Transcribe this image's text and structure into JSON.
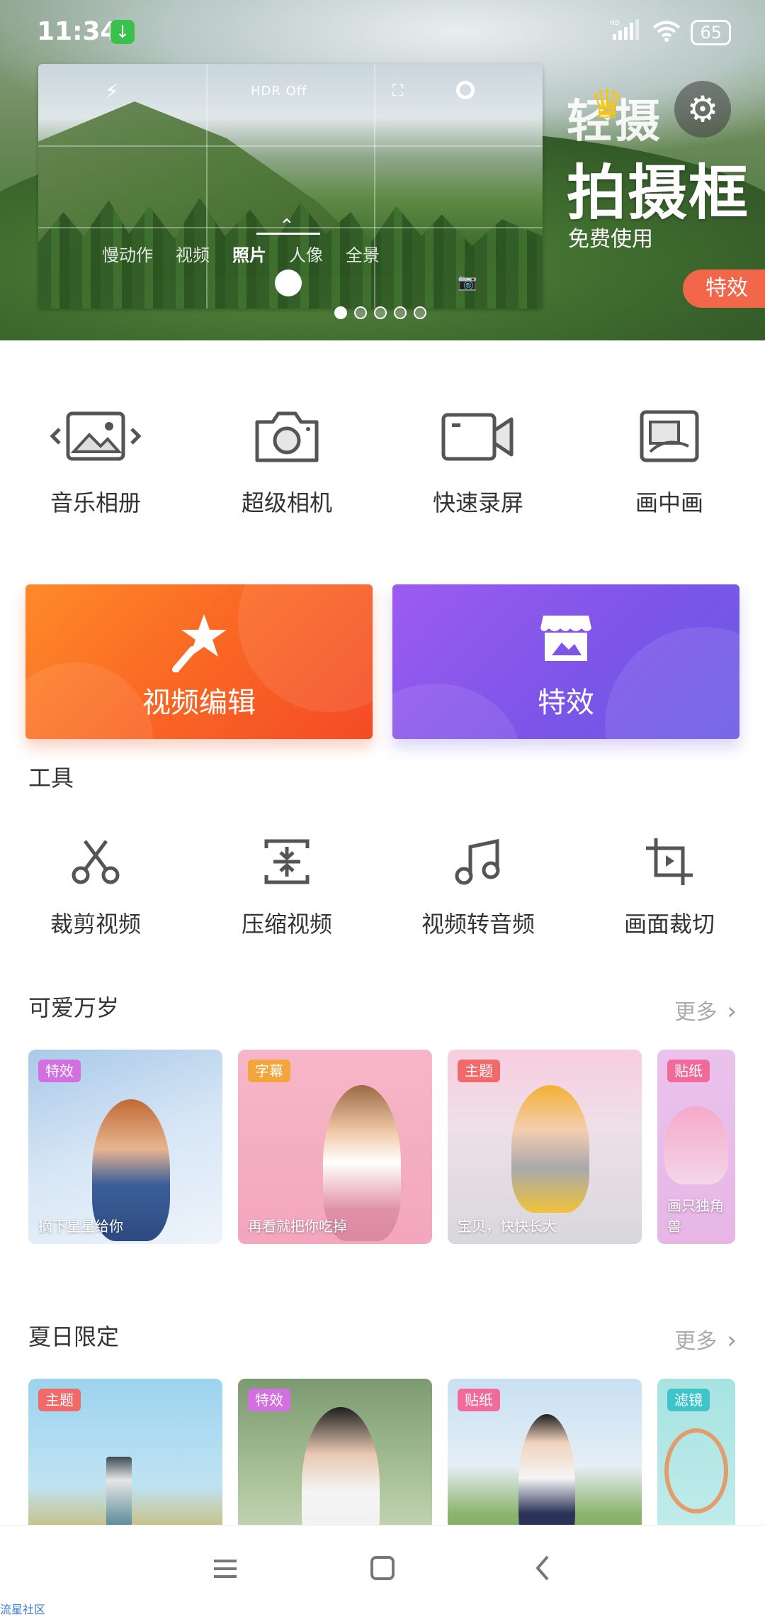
{
  "status": {
    "time": "11:34",
    "battery": "65",
    "signal": "HD"
  },
  "banner": {
    "camera": {
      "hdr": "HDR Off",
      "modes": [
        "慢动作",
        "视频",
        "照片",
        "人像",
        "全景"
      ],
      "active_mode": "照片"
    },
    "promo_sub": "轻摄",
    "promo_title": "拍摄框",
    "promo_free": "免费使用",
    "promo_tag": "特效",
    "dots_count": 5,
    "active_dot": 0
  },
  "quick_actions": [
    {
      "label": "音乐相册",
      "icon": "music-album-icon"
    },
    {
      "label": "超级相机",
      "icon": "camera-icon"
    },
    {
      "label": "快速录屏",
      "icon": "screen-record-icon"
    },
    {
      "label": "画中画",
      "icon": "picture-in-picture-icon"
    }
  ],
  "big_cards": [
    {
      "label": "视频编辑",
      "icon": "magic-wand-icon",
      "color": "#f5612a"
    },
    {
      "label": "特效",
      "icon": "effects-store-icon",
      "color": "#7d55e8"
    }
  ],
  "tools": {
    "title": "工具",
    "items": [
      {
        "label": "裁剪视频",
        "icon": "scissors-icon"
      },
      {
        "label": "压缩视频",
        "icon": "compress-icon"
      },
      {
        "label": "视频转音频",
        "icon": "music-note-icon"
      },
      {
        "label": "画面裁切",
        "icon": "crop-icon"
      }
    ]
  },
  "section1": {
    "title": "可爱万岁",
    "more": "更多",
    "items": [
      {
        "tag": "特效",
        "tag_color": "#d46fe0",
        "caption": "摘下星星给你"
      },
      {
        "tag": "字幕",
        "tag_color": "#f2a53a",
        "caption": "再看就把你吃掉"
      },
      {
        "tag": "主题",
        "tag_color": "#f06a6a",
        "caption": "宝贝，快快长大"
      },
      {
        "tag": "贴纸",
        "tag_color": "#f06a9a",
        "caption": "画只独角兽"
      }
    ]
  },
  "section2": {
    "title": "夏日限定",
    "more": "更多",
    "items": [
      {
        "tag": "主题",
        "tag_color": "#f06a6a",
        "caption": ""
      },
      {
        "tag": "特效",
        "tag_color": "#d46fe0",
        "caption": ""
      },
      {
        "tag": "贴纸",
        "tag_color": "#f06a9a",
        "caption": ""
      },
      {
        "tag": "滤镜",
        "tag_color": "#3fc4c9",
        "caption": ""
      }
    ]
  },
  "watermark": "流星社区"
}
